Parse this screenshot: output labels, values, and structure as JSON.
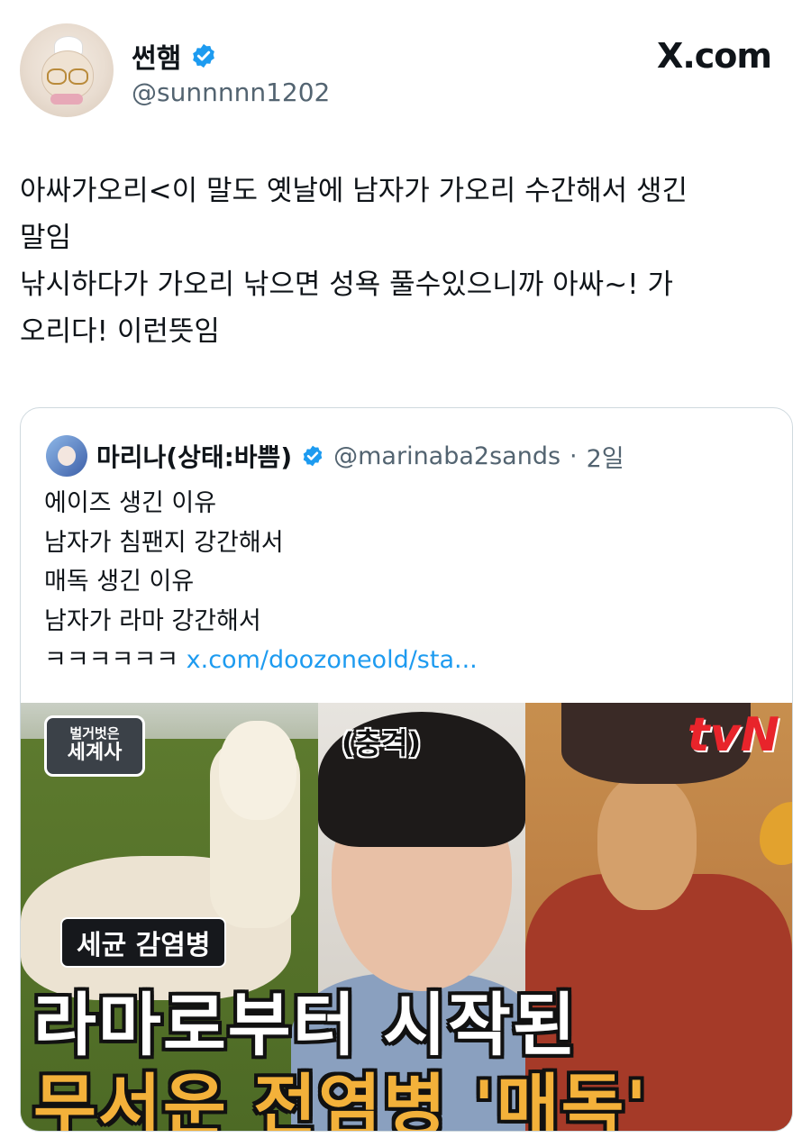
{
  "author": {
    "name": "썬햄",
    "handle": "@sunnnnn1202"
  },
  "brand": "X.com",
  "tweet": {
    "lines": [
      "아싸가오리<이 말도 옛날에 남자가 가오리 수간해서 생긴",
      "말임",
      "낚시하다가 가오리 낚으면 성욕 풀수있으니까 아싸~! 가",
      "오리다! 이런뜻임"
    ]
  },
  "quote": {
    "name": "마리나(상태:바쁨)",
    "handle": "@marinaba2sands",
    "separator": "·",
    "age": "2일",
    "lines": [
      "에이즈 생긴 이유",
      "남자가 침팬지 강간해서",
      "매독 생긴 이유",
      "남자가 라마 강간해서"
    ],
    "last_line_prefix": "ㅋㅋㅋㅋㅋㅋ",
    "link": "x.com/doozoneold/sta..."
  },
  "media": {
    "show_logo_line1": "벌거벗은",
    "show_logo_line2": "세계사",
    "channel": "tvN",
    "shock_caption": "(충격)",
    "tag": "세균 감염병",
    "headline_line1": "라마로부터 시작된",
    "headline_line2": "무서운 전염병 '매독'"
  },
  "colors": {
    "verified": "#1d9bf0",
    "link": "#1d9bf0",
    "headline_accent": "#f3b13a",
    "channel": "#e8242b"
  }
}
